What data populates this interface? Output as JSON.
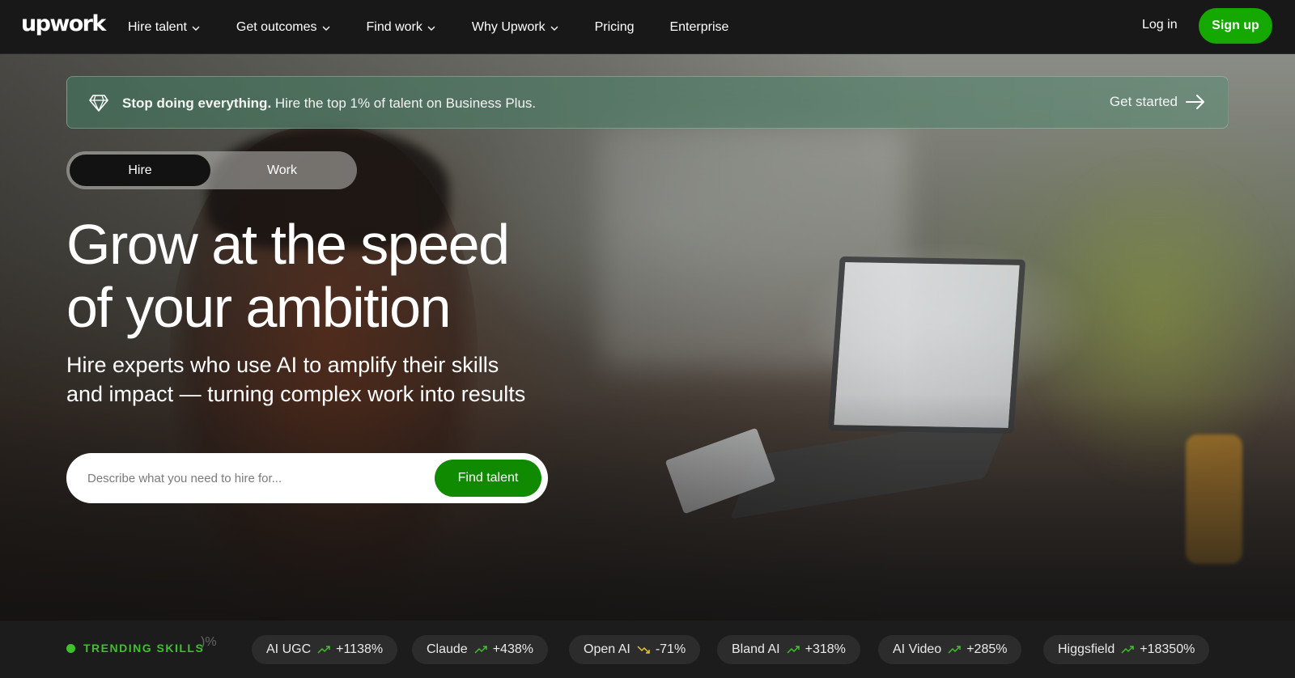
{
  "nav": {
    "logo": "upwork",
    "links": [
      {
        "label": "Hire talent",
        "dropdown": true
      },
      {
        "label": "Get outcomes",
        "dropdown": true
      },
      {
        "label": "Find work",
        "dropdown": true
      },
      {
        "label": "Why Upwork",
        "dropdown": true
      },
      {
        "label": "Pricing",
        "dropdown": false
      },
      {
        "label": "Enterprise",
        "dropdown": false
      }
    ],
    "login": "Log in",
    "signup": "Sign up"
  },
  "banner": {
    "bold": "Stop doing everything.",
    "text": " Hire the top 1% of talent on Business Plus.",
    "cta": "Get started"
  },
  "toggle": {
    "hire": "Hire",
    "work": "Work",
    "active": "Hire"
  },
  "hero": {
    "headline_line1": "Grow at the speed",
    "headline_line2": "of your ambition",
    "subhead_line1": "Hire experts who use AI to amplify their skills",
    "subhead_line2": "and impact — turning complex work into results"
  },
  "search": {
    "placeholder": "Describe what you need to hire for...",
    "value": "",
    "button": "Find talent"
  },
  "trending": {
    "label": "TRENDING SKILLS",
    "faded": ")%",
    "skills": [
      {
        "name": "AI UGC",
        "change": "+1138%",
        "direction": "up"
      },
      {
        "name": "Claude",
        "change": "+438%",
        "direction": "up"
      },
      {
        "name": "Open AI",
        "change": "-71%",
        "direction": "down"
      },
      {
        "name": "Bland AI",
        "change": "+318%",
        "direction": "up"
      },
      {
        "name": "AI Video",
        "change": "+285%",
        "direction": "up"
      },
      {
        "name": "Higgsfield",
        "change": "+18350%",
        "direction": "up"
      }
    ]
  },
  "colors": {
    "brand_green": "#14a800",
    "button_green": "#108a00",
    "trend_up": "#3ec12a",
    "trend_down": "#e8c53a",
    "nav_bg": "#181818"
  }
}
